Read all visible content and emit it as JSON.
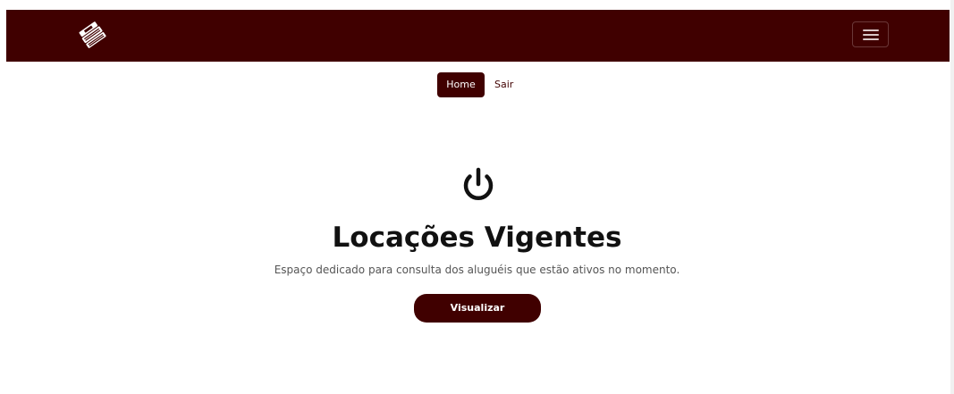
{
  "colors": {
    "brand": "#400000",
    "background": "#ffffff",
    "text": "#111111"
  },
  "navbar": {
    "logo_icon": "books-stack-icon",
    "menu_icon": "hamburger-menu-icon"
  },
  "subnav": {
    "home_label": "Home",
    "logout_label": "Sair"
  },
  "hero": {
    "icon": "power-icon",
    "title": "Locações Vigentes",
    "description": "Espaço dedicado para consulta dos aluguéis que estão ativos no momento.",
    "button_label": "Visualizar"
  }
}
